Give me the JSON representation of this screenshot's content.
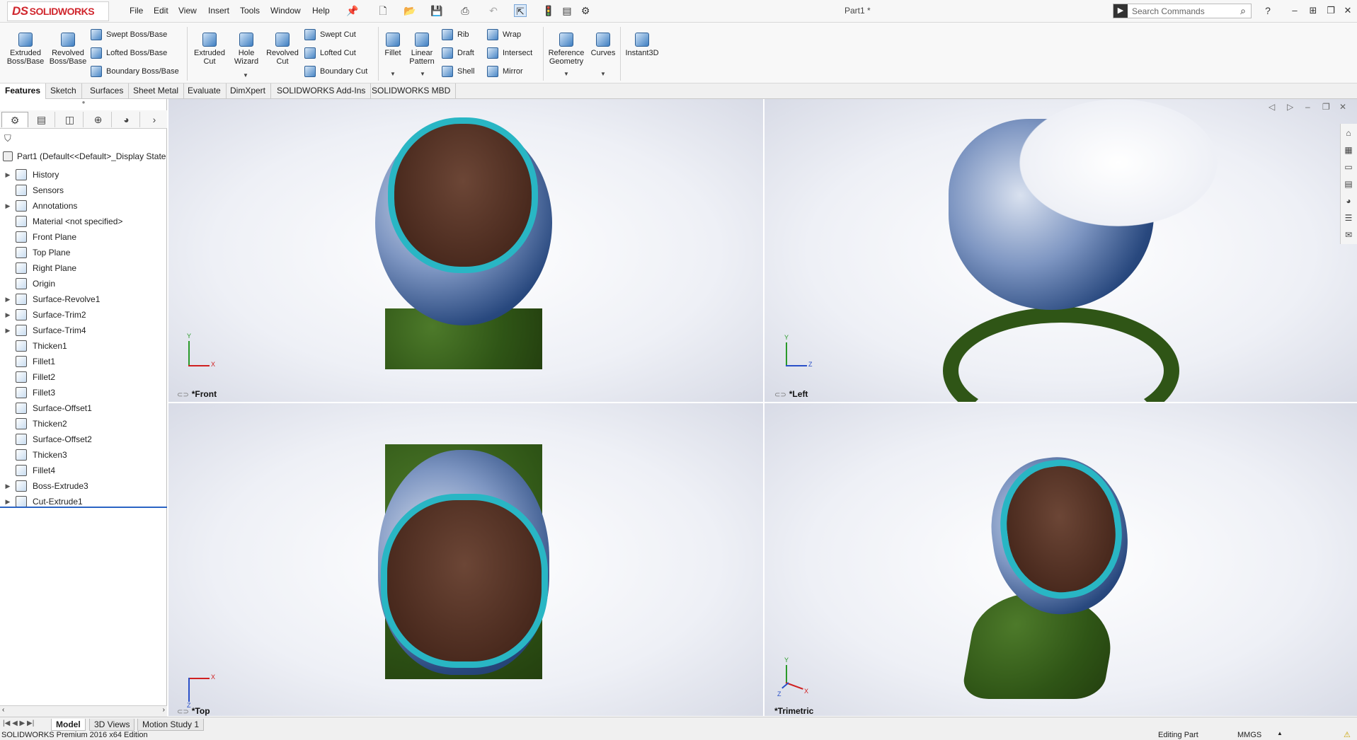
{
  "app": {
    "logo_ds": "DS",
    "logo_text": "SOLIDWORKS",
    "doc_title": "Part1 *"
  },
  "menu": [
    "File",
    "Edit",
    "View",
    "Insert",
    "Tools",
    "Window",
    "Help"
  ],
  "search": {
    "placeholder": "Search Commands"
  },
  "ribbon": {
    "extruded_boss": "Extruded Boss/Base",
    "revolved_boss": "Revolved Boss/Base",
    "swept_boss": "Swept Boss/Base",
    "lofted_boss": "Lofted Boss/Base",
    "boundary_boss": "Boundary Boss/Base",
    "extruded_cut": "Extruded Cut",
    "hole_wizard": "Hole Wizard",
    "revolved_cut": "Revolved Cut",
    "swept_cut": "Swept Cut",
    "lofted_cut": "Lofted Cut",
    "boundary_cut": "Boundary Cut",
    "fillet": "Fillet",
    "linear_pattern": "Linear Pattern",
    "rib": "Rib",
    "draft": "Draft",
    "shell": "Shell",
    "wrap": "Wrap",
    "intersect": "Intersect",
    "mirror": "Mirror",
    "reference_geometry": "Reference Geometry",
    "curves": "Curves",
    "instant3d": "Instant3D"
  },
  "command_tabs": [
    "Features",
    "Sketch",
    "Surfaces",
    "Sheet Metal",
    "Evaluate",
    "DimXpert",
    "SOLIDWORKS Add-Ins",
    "SOLIDWORKS MBD"
  ],
  "feature_manager": {
    "root": "Part1  (Default<<Default>_Display State",
    "items": [
      {
        "label": "History",
        "expand": true
      },
      {
        "label": "Sensors",
        "expand": false
      },
      {
        "label": "Annotations",
        "expand": true
      },
      {
        "label": "Material <not specified>",
        "expand": false
      },
      {
        "label": "Front Plane",
        "expand": false
      },
      {
        "label": "Top Plane",
        "expand": false
      },
      {
        "label": "Right Plane",
        "expand": false
      },
      {
        "label": "Origin",
        "expand": false
      },
      {
        "label": "Surface-Revolve1",
        "expand": true
      },
      {
        "label": "Surface-Trim2",
        "expand": true
      },
      {
        "label": "Surface-Trim4",
        "expand": true
      },
      {
        "label": "Thicken1",
        "expand": false
      },
      {
        "label": "Fillet1",
        "expand": false
      },
      {
        "label": "Fillet2",
        "expand": false
      },
      {
        "label": "Fillet3",
        "expand": false
      },
      {
        "label": "Surface-Offset1",
        "expand": false
      },
      {
        "label": "Thicken2",
        "expand": false
      },
      {
        "label": "Surface-Offset2",
        "expand": false
      },
      {
        "label": "Thicken3",
        "expand": false
      },
      {
        "label": "Fillet4",
        "expand": false
      },
      {
        "label": "Boss-Extrude3",
        "expand": true
      },
      {
        "label": "Cut-Extrude1",
        "expand": true
      }
    ]
  },
  "viewports": {
    "front": "*Front",
    "left": "*Left",
    "top": "*Top",
    "trimetric": "*Trimetric"
  },
  "axes": {
    "x": "X",
    "y": "Y",
    "z": "Z"
  },
  "bottom_tabs": [
    "Model",
    "3D Views",
    "Motion Study 1"
  ],
  "status": {
    "edition": "SOLIDWORKS Premium 2016 x64 Edition",
    "mode": "Editing Part",
    "units": "MMGS"
  },
  "colors": {
    "accent": "#d0262d",
    "rim": "#29b6c4",
    "seat": "#4a2a1e",
    "base": "#2f5516"
  }
}
